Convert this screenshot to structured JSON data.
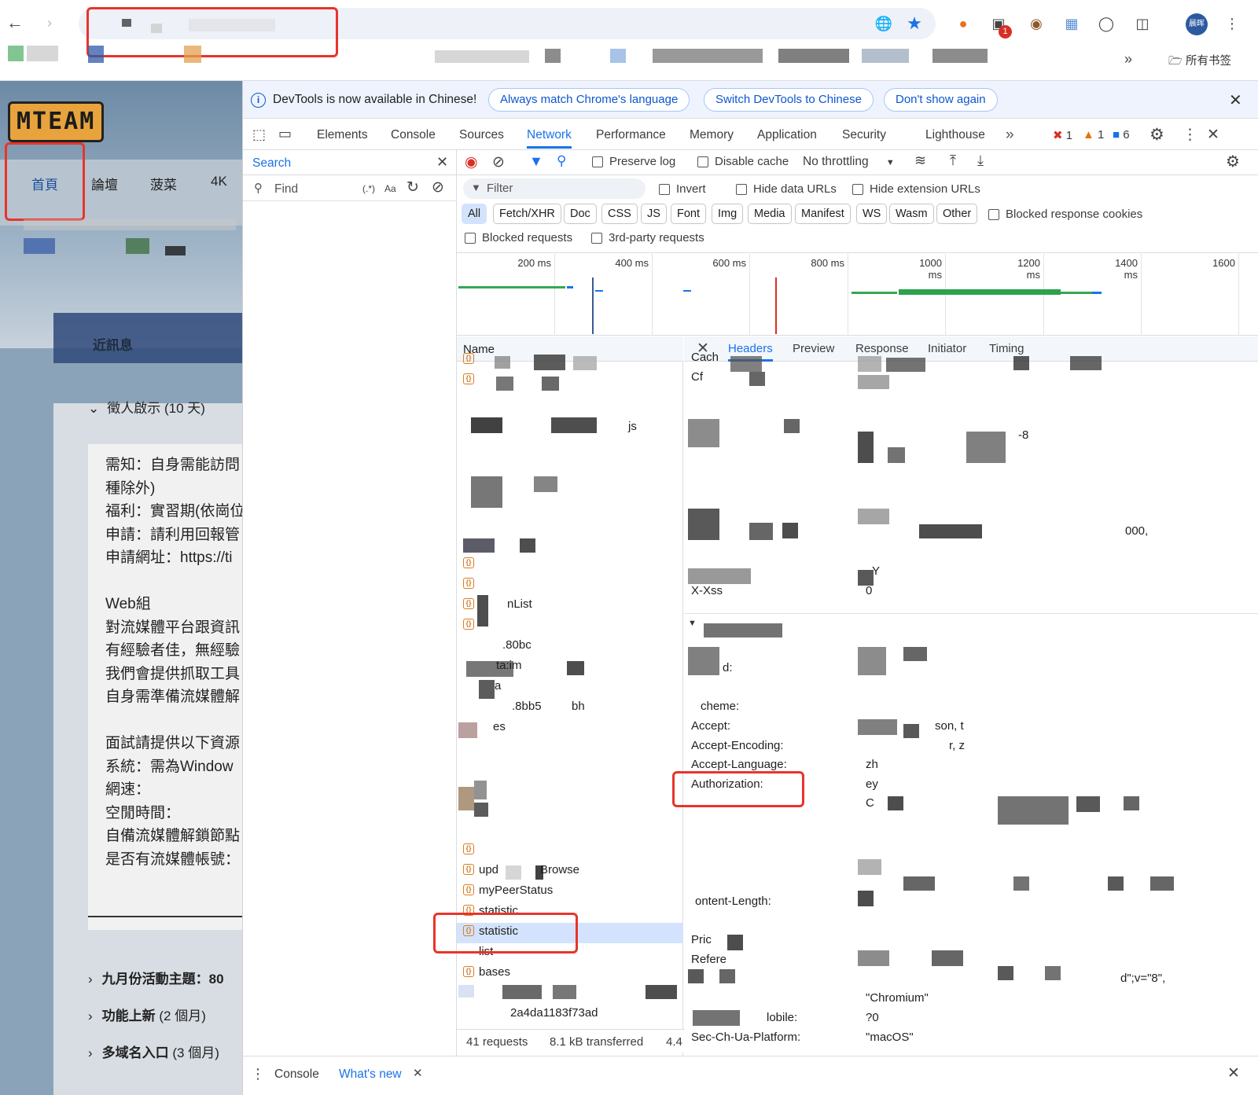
{
  "browser": {
    "bookmarks_label": "所有书签",
    "profile_label": "晨晖",
    "notification_badge": "1"
  },
  "site": {
    "logo_text": "MTEAM",
    "nav": [
      "首頁",
      "論壇",
      "菠菜",
      "4K"
    ],
    "section_heading": "近訊息",
    "notice_title": "徵人啟示 (10 天)",
    "notice_lines": [
      "需知：自身需能訪問",
      "種除外)",
      "福利：實習期(依崗位",
      "申請：請利用回報管",
      "申請網址：https://ti",
      "",
      "Web組",
      "對流媒體平台跟資訊",
      "有經驗者佳，無經驗",
      "我們會提供抓取工具",
      "自身需準備流媒體解",
      "",
      "面試請提供以下資源",
      "系統：需為Window",
      "網速：",
      "空閒時間：",
      "自備流媒體解鎖節點",
      "是否有流媒體帳號："
    ],
    "collapsed": [
      {
        "title": "九月份活動主題：80",
        "suffix": ""
      },
      {
        "title": "功能上新",
        "suffix": " (2 個月)"
      },
      {
        "title": "多域名入口",
        "suffix": " (3 個月)"
      }
    ]
  },
  "devtools": {
    "infobar": {
      "message": "DevTools is now available in Chinese!",
      "btn_match": "Always match Chrome's language",
      "btn_switch": "Switch DevTools to Chinese",
      "btn_dont": "Don't show again"
    },
    "tabs": [
      "Elements",
      "Console",
      "Sources",
      "Network",
      "Performance",
      "Memory",
      "Application",
      "Security",
      "Lighthouse"
    ],
    "active_tab": "Network",
    "errors": "1",
    "warnings": "1",
    "messages": "6",
    "search": {
      "title": "Search",
      "find_placeholder": "Find",
      "regex_label": "(.*)",
      "case_label": "Aa"
    },
    "toolbar": {
      "preserve_log": "Preserve log",
      "disable_cache": "Disable cache",
      "throttling": "No throttling"
    },
    "filter": {
      "placeholder": "Filter",
      "invert": "Invert",
      "hide_data": "Hide data URLs",
      "hide_ext": "Hide extension URLs",
      "types": [
        "All",
        "Fetch/XHR",
        "Doc",
        "CSS",
        "JS",
        "Font",
        "Img",
        "Media",
        "Manifest",
        "WS",
        "Wasm",
        "Other"
      ],
      "blocked_cookies": "Blocked response cookies",
      "blocked_requests": "Blocked requests",
      "third_party": "3rd-party requests"
    },
    "timeline_ticks": [
      "200 ms",
      "400 ms",
      "600 ms",
      "800 ms",
      "1000 ms",
      "1200 ms",
      "1400 ms",
      "1600"
    ],
    "requests": {
      "column": "Name",
      "visible_names": [
        "js",
        "nList",
        ".80bc",
        "ta:im",
        "a",
        ".8bb5",
        "bh",
        "es",
        "upd",
        "Browse",
        "myPeerStatus",
        "statistic",
        "statistic",
        "list",
        "bases",
        "2a4da1183f73ad"
      ],
      "selected": "statistic",
      "status": {
        "count": "41 requests",
        "transferred": "8.1 kB transferred",
        "more": "4.4"
      }
    },
    "detail_tabs": [
      "Headers",
      "Preview",
      "Response",
      "Initiator",
      "Timing"
    ],
    "active_detail_tab": "Headers",
    "headers": {
      "cache": "Cach",
      "cf": "Cf",
      "charset": "-8",
      "num": "000,",
      "y": "Y",
      "xxss": "X-Xss",
      "xxss_val": "0",
      "d": "d:",
      "scheme": "cheme:",
      "accept": "Accept:",
      "accept_val": "son, t",
      "accept_encoding": "Accept-Encoding:",
      "accept_encoding_val": "r, z",
      "accept_language": "Accept-Language:",
      "accept_language_val": "zh",
      "authorization": "Authorization:",
      "authorization_val": "ey",
      "auth_more": "C",
      "content_length": "ontent-Length:",
      "prio": "Pric",
      "referer": "Refere",
      "ua_val": "d\";v=\"8\",",
      "ua_val2": "\"Chromium\"",
      "mobile": "lobile:",
      "mobile_val": "?0",
      "platform": "Sec-Ch-Ua-Platform:",
      "platform_val": "\"macOS\""
    },
    "drawer": {
      "console": "Console",
      "whats_new": "What's new"
    }
  }
}
